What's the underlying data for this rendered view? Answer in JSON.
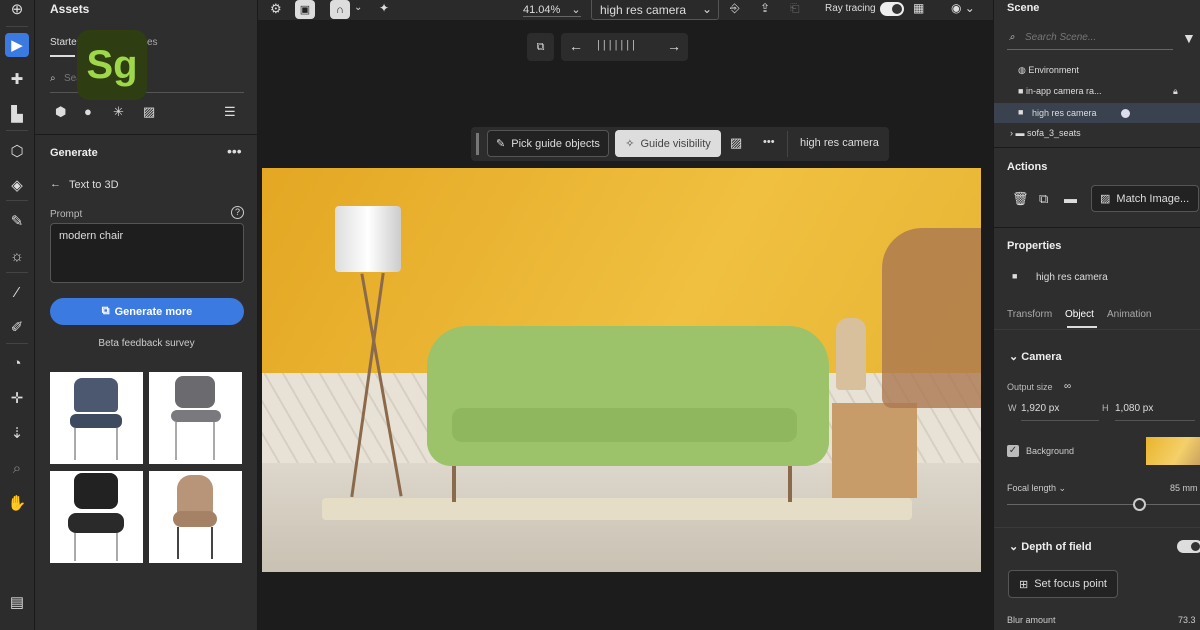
{
  "app": {
    "logo_text": "Sg",
    "brand_color": "#9ed84a",
    "logo_bg": "#2f3d12"
  },
  "assets": {
    "title": "Assets",
    "tab_starter": "Starter",
    "tab_other": "es",
    "search_placeholder": "Search assets..."
  },
  "generate": {
    "title": "Generate",
    "mode": "Text to 3D",
    "prompt_label": "Prompt",
    "prompt_value": "modern chair",
    "button": "Generate more",
    "survey": "Beta feedback survey",
    "accent": "#3b7ae0"
  },
  "topbar": {
    "zoom": "41.04%",
    "camera": "high res camera",
    "ray_tracing": "Ray tracing"
  },
  "guide_bar": {
    "pick": "Pick guide objects",
    "visibility": "Guide visibility",
    "more": "•••",
    "camera": "high res camera"
  },
  "scene": {
    "title": "Scene",
    "search_placeholder": "Search Scene...",
    "items": [
      {
        "label": "Environment",
        "icon": "globe-icon"
      },
      {
        "label": "in-app camera ra...",
        "icon": "camera-icon",
        "locked": true
      },
      {
        "label": "high res camera",
        "icon": "camera-icon",
        "selected": true
      },
      {
        "label": "sofa_3_seats",
        "icon": "folder-icon"
      }
    ]
  },
  "actions": {
    "title": "Actions",
    "match_image": "Match Image..."
  },
  "properties": {
    "title": "Properties",
    "object": "high res camera",
    "tabs": [
      "Transform",
      "Object",
      "Animation"
    ],
    "active_tab": "Object",
    "camera_section": "Camera",
    "output_size": "Output size",
    "w_label": "W",
    "w_value": "1,920 px",
    "h_label": "H",
    "h_value": "1,080 px",
    "background_label": "Background",
    "background_checked": true,
    "focal_length": "Focal length",
    "focal_value": "85 mm",
    "focal_slider_fraction": 0.68,
    "dof_section": "Depth of field",
    "dof_enabled": true,
    "set_focus": "Set focus point",
    "blur_label": "Blur amount",
    "blur_value": "73.3"
  }
}
